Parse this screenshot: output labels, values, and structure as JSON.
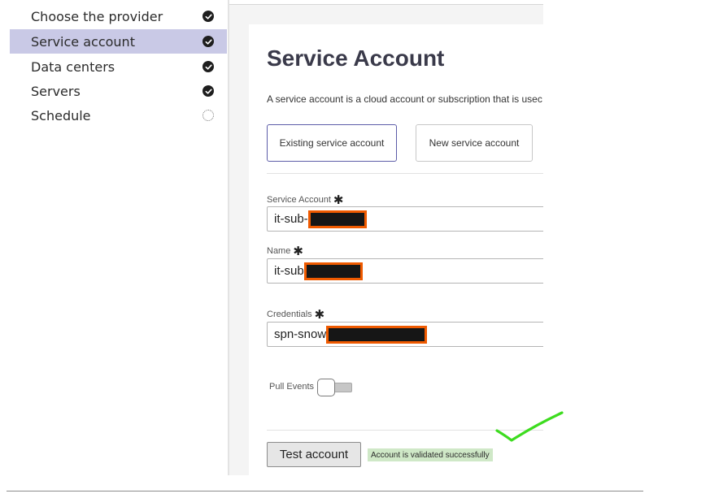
{
  "sidebar": {
    "steps": [
      {
        "label": "Choose the provider",
        "status": "complete",
        "icon": "check-circle-icon"
      },
      {
        "label": "Service account",
        "status": "complete",
        "icon": "check-circle-icon",
        "active": true
      },
      {
        "label": "Data centers",
        "status": "complete",
        "icon": "check-circle-icon"
      },
      {
        "label": "Servers",
        "status": "complete",
        "icon": "check-circle-icon"
      },
      {
        "label": "Schedule",
        "status": "pending",
        "icon": "dotted-circle-icon"
      }
    ]
  },
  "main": {
    "title": "Service Account",
    "description": "A service account is a cloud account or subscription that is usec",
    "account_choice": {
      "existing_label": "Existing service account",
      "new_label": "New service account",
      "selected": "existing"
    },
    "fields": {
      "service_account": {
        "label": "Service Account",
        "value": "it-sub-",
        "required": true
      },
      "name": {
        "label": "Name",
        "value": "it-sub",
        "required": true
      },
      "credentials": {
        "label": "Credentials",
        "value": "spn-snow",
        "required": true
      }
    },
    "required_marker": "✱",
    "pull_events": {
      "label": "Pull Events",
      "enabled": false
    },
    "test_button_label": "Test account",
    "status_message": "Account is validated successfully"
  },
  "colors": {
    "active_step_bg": "#c9c9e6",
    "selected_border": "#5c5ca8",
    "redaction_border": "#ef5a00",
    "success_badge_bg": "#cfe8c7",
    "annotation_check": "#3ddc1f"
  }
}
